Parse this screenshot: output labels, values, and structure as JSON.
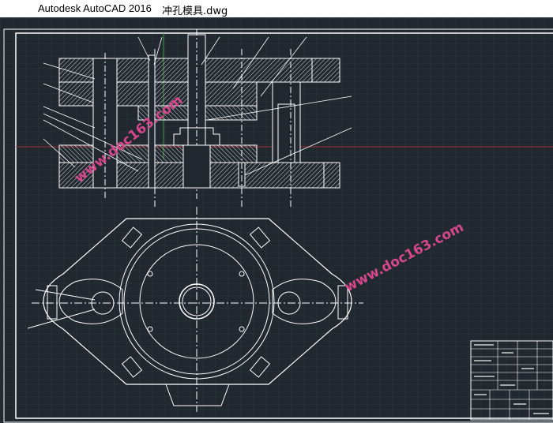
{
  "window": {
    "app_title": "Autodesk AutoCAD 2016",
    "file_name": "冲孔模具.dwg"
  },
  "watermarks": {
    "top": "www.doc163.com",
    "right": "www.doc163.com"
  },
  "colors": {
    "background": "#212830",
    "line": "#ffffff",
    "grid": "#2c3540",
    "crosshair_red": "#a03030",
    "crosshair_green": "#3a9a3a",
    "watermark": "#d6478c"
  },
  "icons": {
    "crosshair": "crosshair-cursor-icon"
  }
}
